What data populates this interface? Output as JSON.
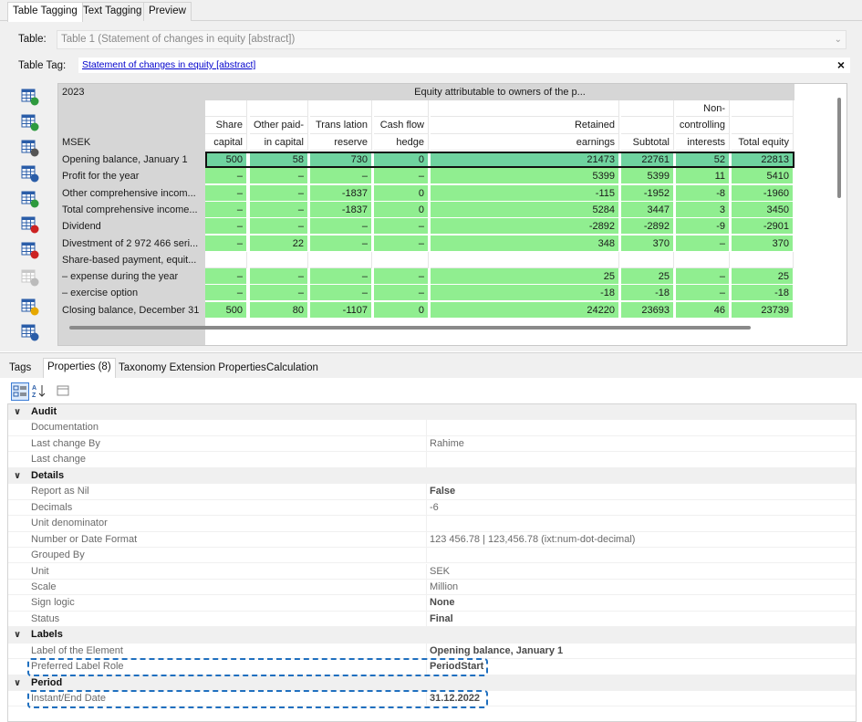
{
  "top_tabs": [
    "Table Tagging",
    "Text Tagging",
    "Preview"
  ],
  "table_label": "Table:",
  "table_value": "Table 1 (Statement of changes in equity [abstract])",
  "table_tag_label": "Table Tag:",
  "table_tag_link": "Statement of changes in equity [abstract]",
  "close_symbol": "×",
  "grid": {
    "year": "2023",
    "group_header": "Equity attributable to owners of the p...",
    "unit_label": "MSEK",
    "columns": [
      {
        "l1": "",
        "l2": "Share",
        "l3": "capital"
      },
      {
        "l1": "",
        "l2": "Other paid-",
        "l3": "in capital"
      },
      {
        "l1": "",
        "l2": "Trans lation",
        "l3": "reserve"
      },
      {
        "l1": "",
        "l2": "Cash flow",
        "l3": "hedge"
      },
      {
        "l1": "",
        "l2": "Retained",
        "l3": "earnings"
      },
      {
        "l1": "",
        "l2": "",
        "l3": "Subtotal"
      },
      {
        "l1": "Non-",
        "l2": "controlling",
        "l3": "interests"
      },
      {
        "l1": "",
        "l2": "",
        "l3": "Total equity"
      }
    ],
    "rows": [
      {
        "label": "Opening balance, January 1",
        "values": [
          "500",
          "58",
          "730",
          "0",
          "21473",
          "22761",
          "52",
          "22813"
        ]
      },
      {
        "label": "Profit for the year",
        "values": [
          "–",
          "–",
          "–",
          "–",
          "5399",
          "5399",
          "11",
          "5410"
        ]
      },
      {
        "label": "Other comprehensive incom...",
        "values": [
          "–",
          "–",
          "-1837",
          "0",
          "-115",
          "-1952",
          "-8",
          "-1960"
        ]
      },
      {
        "label": "Total comprehensive income...",
        "values": [
          "–",
          "–",
          "-1837",
          "0",
          "5284",
          "3447",
          "3",
          "3450"
        ]
      },
      {
        "label": "Dividend",
        "values": [
          "–",
          "–",
          "–",
          "–",
          "-2892",
          "-2892",
          "-9",
          "-2901"
        ]
      },
      {
        "label": "Divestment of 2 972 466 seri...",
        "values": [
          "–",
          "22",
          "–",
          "–",
          "348",
          "370",
          "–",
          "370"
        ]
      },
      {
        "label": "Share-based payment, equit...",
        "values": [
          "",
          "",
          "",
          "",
          "",
          "",
          "",
          ""
        ]
      },
      {
        "label": "– expense during the year",
        "values": [
          "–",
          "–",
          "–",
          "–",
          "25",
          "25",
          "–",
          "25"
        ]
      },
      {
        "label": "– exercise option",
        "values": [
          "–",
          "–",
          "–",
          "–",
          "-18",
          "-18",
          "–",
          "-18"
        ]
      },
      {
        "label": "Closing balance, December 31",
        "values": [
          "500",
          "80",
          "-1107",
          "0",
          "24220",
          "23693",
          "46",
          "23739"
        ]
      }
    ]
  },
  "bottom_tabs": [
    "Tags",
    "Properties (8)",
    "Taxonomy Extension Properties",
    "Calculation"
  ],
  "properties": [
    {
      "type": "cat",
      "name": "Audit"
    },
    {
      "type": "item",
      "name": "Documentation",
      "value": ""
    },
    {
      "type": "item",
      "name": "Last change By",
      "value": "Rahime"
    },
    {
      "type": "item",
      "name": "Last change",
      "value": ""
    },
    {
      "type": "cat",
      "name": "Details"
    },
    {
      "type": "item",
      "name": "Report as Nil",
      "value": "False",
      "bold": true
    },
    {
      "type": "item",
      "name": "Decimals",
      "value": "-6"
    },
    {
      "type": "item",
      "name": "Unit denominator",
      "value": ""
    },
    {
      "type": "item",
      "name": "Number or Date Format",
      "value": "123 456.78 | 123,456.78 (ixt:num-dot-decimal)"
    },
    {
      "type": "item",
      "name": "Grouped By",
      "value": ""
    },
    {
      "type": "item",
      "name": "Unit",
      "value": "SEK"
    },
    {
      "type": "item",
      "name": "Scale",
      "value": "Million"
    },
    {
      "type": "item",
      "name": "Sign logic",
      "value": "None",
      "bold": true
    },
    {
      "type": "item",
      "name": "Status",
      "value": "Final",
      "bold": true
    },
    {
      "type": "cat",
      "name": "Labels"
    },
    {
      "type": "item",
      "name": "Label of the Element",
      "value": "Opening balance, January 1",
      "bold": true
    },
    {
      "type": "item",
      "name": "Preferred Label Role",
      "value": "PeriodStart",
      "bold": true
    },
    {
      "type": "cat",
      "name": "Period"
    },
    {
      "type": "item",
      "name": "Instant/End Date",
      "value": "31.12.2022",
      "bold": true
    }
  ],
  "colors": {
    "cell_green": "#90ee90",
    "cell_selected": "#6fd39f",
    "highlight_border": "#1f6fbf"
  },
  "icons": [
    "table-add-icon",
    "table-columns-icon",
    "table-edit-icon",
    "table-grid-icon",
    "table-add-row-icon",
    "table-remove-icon",
    "table-delete-icon",
    "table-disabled-icon",
    "table-star-icon",
    "table-settings-icon"
  ]
}
